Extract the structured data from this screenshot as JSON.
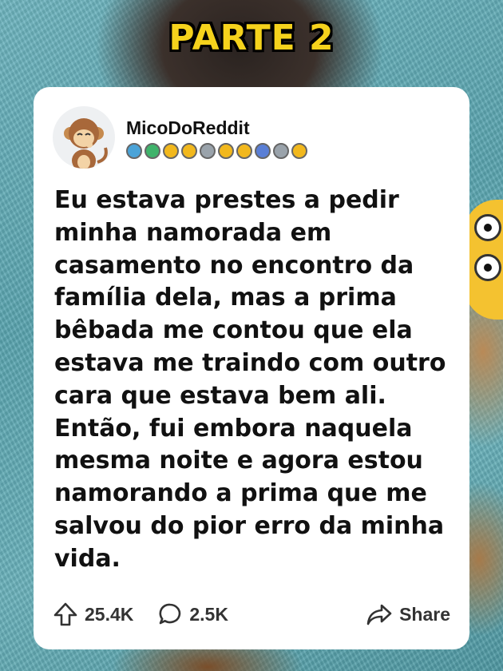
{
  "overlay": {
    "title": "PARTE 2"
  },
  "post": {
    "username": "MicoDoReddit",
    "avatar_icon": "monkey-icon",
    "badges": [
      {
        "name": "badge-1-icon",
        "color": "#4aa3d8"
      },
      {
        "name": "badge-2-icon",
        "color": "#3fb36b"
      },
      {
        "name": "badge-3-icon",
        "color": "#f2b81d"
      },
      {
        "name": "badge-4-icon",
        "color": "#f2b81d"
      },
      {
        "name": "badge-5-icon",
        "color": "#9aa3ab"
      },
      {
        "name": "badge-6-icon",
        "color": "#f2b81d"
      },
      {
        "name": "badge-7-icon",
        "color": "#f2b81d"
      },
      {
        "name": "badge-8-icon",
        "color": "#5a7fd6"
      },
      {
        "name": "badge-9-icon",
        "color": "#9aa3ab"
      },
      {
        "name": "badge-10-icon",
        "color": "#f2b81d"
      }
    ],
    "body": "Eu estava prestes a pedir minha namorada em casamento no encontro da família dela, mas a prima bêbada me contou que ela estava me traindo com outro cara que estava bem ali. Então, fui embora naquela mesma noite e agora estou namorando a prima que me salvou do pior erro da minha vida.",
    "upvotes": "25.4K",
    "comments": "2.5K",
    "share_label": "Share"
  },
  "colors": {
    "title_fill": "#f5d21c",
    "card_bg": "#ffffff",
    "text": "#111111"
  }
}
